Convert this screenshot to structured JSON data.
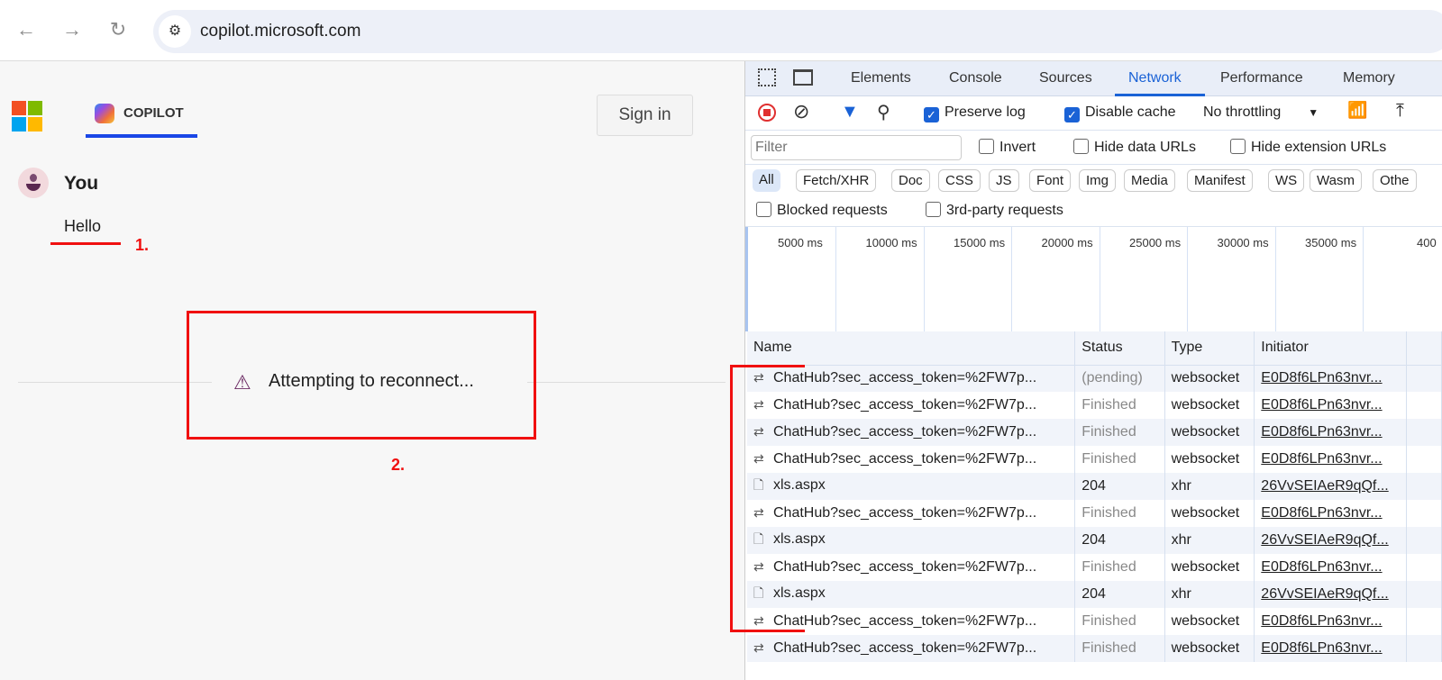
{
  "browser": {
    "url": "copilot.microsoft.com"
  },
  "page": {
    "brand": "COPILOT",
    "sign_in": "Sign in",
    "user_name": "You",
    "message": "Hello",
    "status": "Attempting to reconnect...",
    "annotation_1": "1.",
    "annotation_2": "2.",
    "logo_colors": [
      "#f25022",
      "#7fba00",
      "#00a4ef",
      "#ffb900"
    ]
  },
  "devtools": {
    "tabs": [
      "Elements",
      "Console",
      "Sources",
      "Network",
      "Performance",
      "Memory"
    ],
    "active_tab": "Network",
    "toolbar": {
      "preserve_log": "Preserve log",
      "preserve_checked": true,
      "disable_cache": "Disable cache",
      "disable_checked": true,
      "throttling": "No throttling"
    },
    "filter": {
      "placeholder": "Filter",
      "invert": "Invert",
      "hide_data": "Hide data URLs",
      "hide_ext": "Hide extension URLs"
    },
    "chips": [
      "All",
      "Fetch/XHR",
      "Doc",
      "CSS",
      "JS",
      "Font",
      "Img",
      "Media",
      "Manifest",
      "WS",
      "Wasm",
      "Othe"
    ],
    "blocked": "Blocked requests",
    "third_party": "3rd-party requests",
    "timeline": [
      "5000 ms",
      "10000 ms",
      "15000 ms",
      "20000 ms",
      "25000 ms",
      "30000 ms",
      "35000 ms",
      "400"
    ],
    "columns": [
      "Name",
      "Status",
      "Type",
      "Initiator"
    ],
    "rows": [
      {
        "name": "ChatHub?sec_access_token=%2FW7p...",
        "status": "(pending)",
        "type": "websocket",
        "initiator": "E0D8f6LPn63nvr...",
        "icon": "websocket"
      },
      {
        "name": "ChatHub?sec_access_token=%2FW7p...",
        "status": "Finished",
        "type": "websocket",
        "initiator": "E0D8f6LPn63nvr...",
        "icon": "websocket"
      },
      {
        "name": "ChatHub?sec_access_token=%2FW7p...",
        "status": "Finished",
        "type": "websocket",
        "initiator": "E0D8f6LPn63nvr...",
        "icon": "websocket"
      },
      {
        "name": "ChatHub?sec_access_token=%2FW7p...",
        "status": "Finished",
        "type": "websocket",
        "initiator": "E0D8f6LPn63nvr...",
        "icon": "websocket"
      },
      {
        "name": "xls.aspx",
        "status": "204",
        "type": "xhr",
        "initiator": "26VvSEIAeR9qQf...",
        "icon": "document"
      },
      {
        "name": "ChatHub?sec_access_token=%2FW7p...",
        "status": "Finished",
        "type": "websocket",
        "initiator": "E0D8f6LPn63nvr...",
        "icon": "websocket"
      },
      {
        "name": "xls.aspx",
        "status": "204",
        "type": "xhr",
        "initiator": "26VvSEIAeR9qQf...",
        "icon": "document"
      },
      {
        "name": "ChatHub?sec_access_token=%2FW7p...",
        "status": "Finished",
        "type": "websocket",
        "initiator": "E0D8f6LPn63nvr...",
        "icon": "websocket"
      },
      {
        "name": "xls.aspx",
        "status": "204",
        "type": "xhr",
        "initiator": "26VvSEIAeR9qQf...",
        "icon": "document"
      },
      {
        "name": "ChatHub?sec_access_token=%2FW7p...",
        "status": "Finished",
        "type": "websocket",
        "initiator": "E0D8f6LPn63nvr...",
        "icon": "websocket"
      },
      {
        "name": "ChatHub?sec_access_token=%2FW7p...",
        "status": "Finished",
        "type": "websocket",
        "initiator": "E0D8f6LPn63nvr...",
        "icon": "websocket"
      }
    ]
  },
  "colors": {
    "accent": "#1a62d6",
    "annotation": "#f01010",
    "copilot_underline": "#1a47e6"
  }
}
